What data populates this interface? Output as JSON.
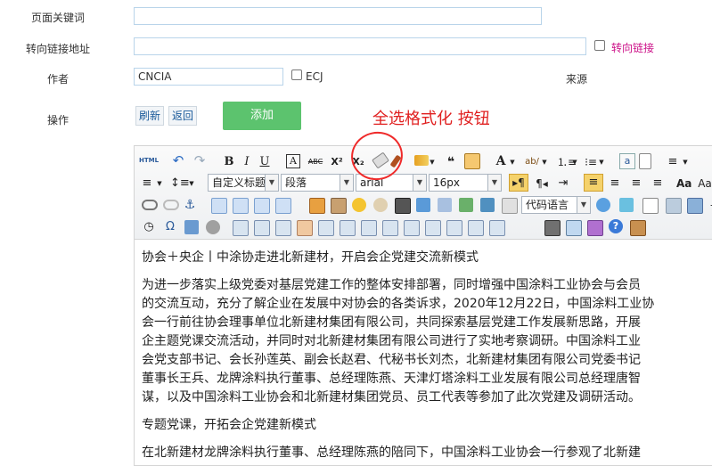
{
  "form": {
    "keywords_label": "页面关键词",
    "redirect_label": "转向链接地址",
    "redirect_check_label": "转向链接",
    "author_label": "作者",
    "author_value": "CNCIA",
    "ecj_label": "ECJ",
    "source_label": "来源",
    "op_label": "操作",
    "refresh_label": "刷新",
    "back_label": "返回",
    "add_label": "添加"
  },
  "annotation": "全选格式化 按钮",
  "toolbar": {
    "html_label": "HTML",
    "bold": "B",
    "italic": "I",
    "underline": "U",
    "font_border": "A",
    "strike": "ABC",
    "superscript": "X²",
    "subscript": "X₂",
    "font_color": "A",
    "quote": "❝",
    "custom_title": "自定义标题",
    "paragraph": "段落",
    "font_family": "arial",
    "font_size": "16px",
    "code_lang": "代码语言",
    "omega": "Ω"
  },
  "content": {
    "title": "协会＋央企丨中涂协走进北新建材，开启会企党建交流新模式",
    "para1": [
      "为进一步落实上级党委对基层党建工作的整体安排部署，同时增强中国涂料工业协会与会员",
      "的交流互动，充分了解企业在发展中对协会的各类诉求，2020年12月22日，中国涂料工业协",
      "会一行前往协会理事单位北新建材集团有限公司，共同探索基层党建工作发展新思路，开展",
      "企主题党课交流活动，并同时对北新建材集团有限公司进行了实地考察调研。中国涂料工业",
      "会党支部书记、会长孙莲英、副会长赵君、代秘书长刘杰，北新建材集团有限公司党委书记",
      "董事长王兵、龙牌涂料执行董事、总经理陈燕、天津灯塔涂料工业发展有限公司总经理唐智",
      "谋，以及中国涂料工业协会和北新建材集团党员、员工代表等参加了此次党建及调研活动。"
    ],
    "subtitle": "专题党课，开拓会企党建新模式",
    "para2": [
      "在北新建材龙牌涂料执行董事、总经理陈燕的陪同下，中国涂料工业协会一行参观了北新建"
    ]
  }
}
